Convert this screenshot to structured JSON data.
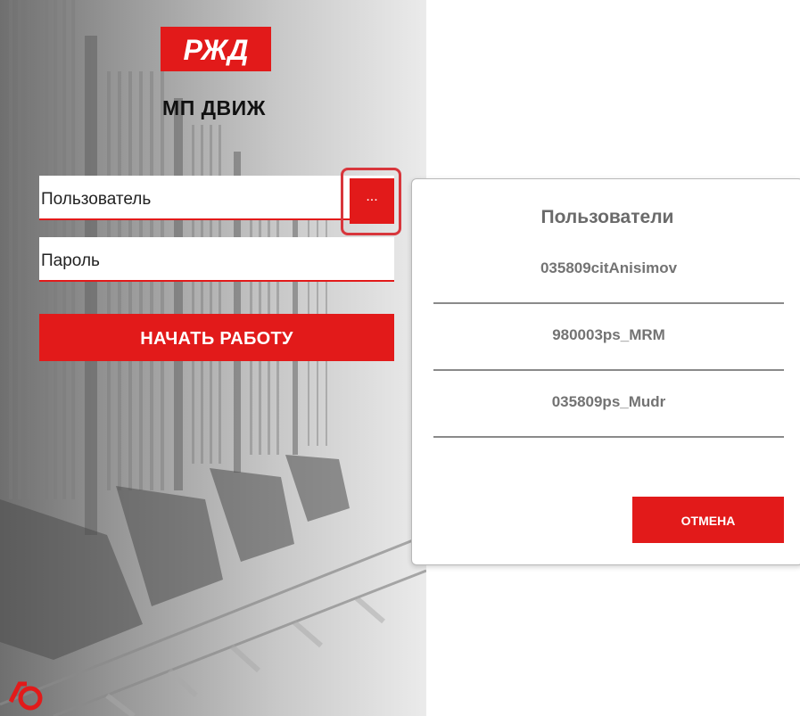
{
  "app": {
    "logo_text": "РЖД",
    "name": "МП ДВИЖ"
  },
  "login": {
    "user_label": "Пользователь",
    "user_list_button_label": "...",
    "password_label": "Пароль",
    "start_label": "НАЧАТЬ РАБОТУ"
  },
  "dialog": {
    "title": "Пользователи",
    "users": [
      "035809citAnisimov",
      "980003ps_MRM",
      "035809ps_Mudr"
    ],
    "cancel_label": "ОТМЕНА"
  },
  "colors": {
    "accent": "#e21a1a",
    "highlight_border": "#d8363c",
    "divider": "#8a8a8a",
    "muted_text": "#737373"
  },
  "icons": {
    "logo": "rzd-logo",
    "corner": "rzd-small-logo-icon"
  }
}
